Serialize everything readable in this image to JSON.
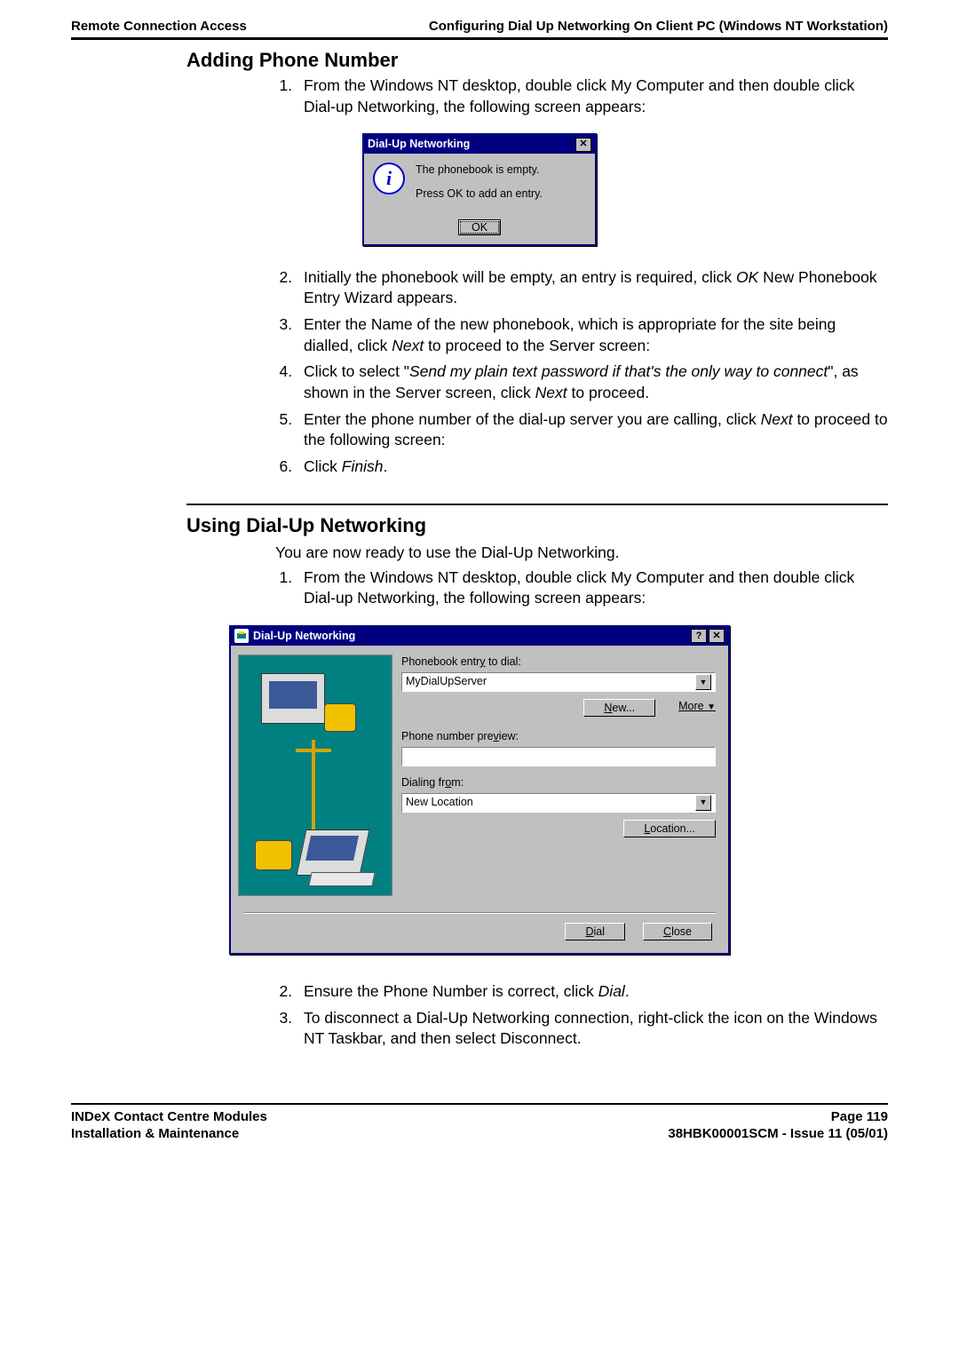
{
  "header": {
    "left": "Remote Connection Access",
    "right": "Configuring Dial Up Networking On Client PC (Windows NT Workstation)"
  },
  "section1": {
    "title": "Adding Phone Number",
    "step1": "From the Windows NT desktop, double click My Computer and then double click Dial-up Networking, the following screen appears:",
    "step2_a": "Initially the phonebook will be empty, an entry is required, click ",
    "step2_ok": "OK",
    "step2_b": " New Phonebook Entry Wizard appears.",
    "step3_a": "Enter the Name of the new phonebook, which is appropriate for the site being dialled, click ",
    "step3_next": "Next",
    "step3_b": " to proceed to the Server screen:",
    "step4_a": "Click to select \"",
    "step4_em": "Send my plain text password if that's the only way to connect",
    "step4_b": "\", as shown in the Server screen, click ",
    "step4_next": "Next",
    "step4_c": " to proceed.",
    "step5_a": "Enter the phone number of the dial-up server you are calling, click ",
    "step5_next": "Next",
    "step5_b": " to proceed to the following screen:",
    "step6_a": "Click ",
    "step6_finish": "Finish",
    "step6_b": "."
  },
  "msgbox": {
    "title": "Dial-Up Networking",
    "line1": "The phonebook is empty.",
    "line2": "Press OK to add an entry.",
    "ok": "OK"
  },
  "section2": {
    "title": "Using Dial-Up Networking",
    "lead": "You are now ready to use the Dial-Up Networking.",
    "step1": "From the Windows NT desktop, double click My Computer and then double click Dial-up Networking, the following screen appears:",
    "step2_a": "Ensure the Phone Number is correct, click ",
    "step2_dial": "Dial",
    "step2_b": ".",
    "step3": "To disconnect a Dial-Up Networking connection, right-click the icon on the Windows NT Taskbar, and then select Disconnect."
  },
  "dun": {
    "title": "Dial-Up Networking",
    "labels": {
      "entry": "Phonebook entry to dial:",
      "entry_value": "MyDialUpServer",
      "new": "New...",
      "more": "More",
      "preview": "Phone number preview:",
      "preview_value": "",
      "from": "Dialing from:",
      "from_value": "New Location",
      "location": "Location...",
      "dial": "Dial",
      "close": "Close"
    }
  },
  "footer": {
    "left1": "INDeX Contact Centre Modules",
    "left2": "Installation & Maintenance",
    "right1": "Page 119",
    "right2": "38HBK00001SCM - Issue 11 (05/01)"
  }
}
